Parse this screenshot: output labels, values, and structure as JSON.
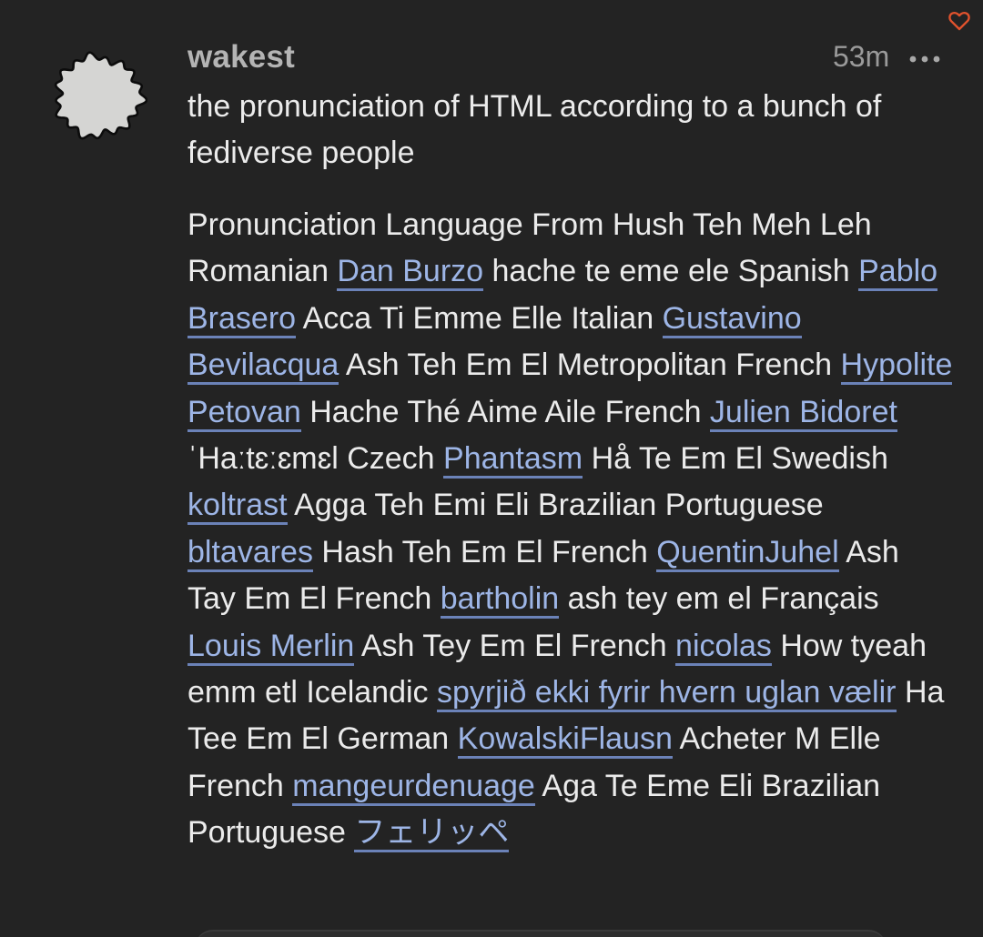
{
  "post": {
    "author": "wakest",
    "time": "53m",
    "summary": "the pronunciation of HTML according to a bunch of fediverse people",
    "accent_color": "#e0522d",
    "link_color": "#9db5e6",
    "icons": {
      "favorite": "heart-outline-icon",
      "more": "more-dots-icon",
      "avatar": "blob-avatar"
    },
    "body": [
      {
        "type": "text",
        "value": "Pronunciation Language From Hush Teh Meh Leh Romanian "
      },
      {
        "type": "link",
        "value": "Dan Burzo"
      },
      {
        "type": "text",
        "value": " hache te eme ele Spanish "
      },
      {
        "type": "link",
        "value": "Pablo Brasero"
      },
      {
        "type": "text",
        "value": " Acca Ti Emme Elle Italian "
      },
      {
        "type": "link",
        "value": "Gustavino Bevilacqua"
      },
      {
        "type": "text",
        "value": " Ash Teh Em El Metropolitan French "
      },
      {
        "type": "link",
        "value": "Hypolite Petovan"
      },
      {
        "type": "text",
        "value": " Hache Thé Aime Aile French "
      },
      {
        "type": "link",
        "value": "Julien Bidoret"
      },
      {
        "type": "text",
        "value": " ˈHaːtɛːɛmɛl Czech "
      },
      {
        "type": "link",
        "value": "Phantasm"
      },
      {
        "type": "text",
        "value": " Hå Te Em El Swedish "
      },
      {
        "type": "link",
        "value": "koltrast"
      },
      {
        "type": "text",
        "value": " Agga Teh Emi Eli Brazilian Portuguese "
      },
      {
        "type": "link",
        "value": "bltavares"
      },
      {
        "type": "text",
        "value": " Hash Teh Em El French "
      },
      {
        "type": "link",
        "value": "QuentinJuhel"
      },
      {
        "type": "text",
        "value": " Ash Tay Em El French "
      },
      {
        "type": "link",
        "value": "bartholin"
      },
      {
        "type": "text",
        "value": " ash tey em el Français "
      },
      {
        "type": "link",
        "value": "Louis Merlin"
      },
      {
        "type": "text",
        "value": " Ash Tey Em El French "
      },
      {
        "type": "link",
        "value": "nicolas"
      },
      {
        "type": "text",
        "value": " How tyeah emm etl Icelandic "
      },
      {
        "type": "link",
        "value": "spyrjið ekki fyrir hvern uglan vælir"
      },
      {
        "type": "text",
        "value": " Ha Tee Em El German "
      },
      {
        "type": "link",
        "value": "KowalskiFlausn"
      },
      {
        "type": "text",
        "value": " Acheter M Elle French "
      },
      {
        "type": "link",
        "value": "mangeurdenuage"
      },
      {
        "type": "text",
        "value": " Aga Te Eme Eli Brazilian Portuguese "
      },
      {
        "type": "link",
        "value": "フェリッペ"
      }
    ]
  }
}
